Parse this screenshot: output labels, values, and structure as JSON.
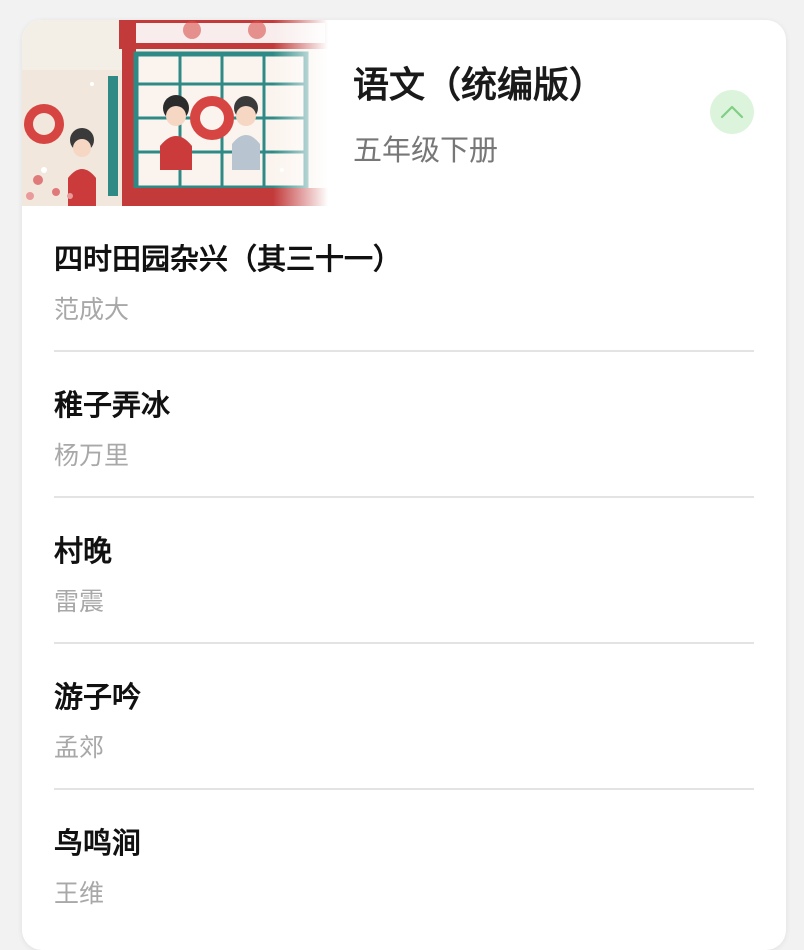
{
  "book": {
    "title": "语文（统编版）",
    "subtitle": "五年级下册",
    "cover_icon": "textbook-cover-illustration"
  },
  "collapse_icon": "chevron-up-icon",
  "colors": {
    "collapse_bg": "#dcf3dc",
    "collapse_chevron": "#7fcf85",
    "divider": "#e3e3e3"
  },
  "poems": [
    {
      "title": "四时田园杂兴（其三十一）",
      "author": "范成大"
    },
    {
      "title": "稚子弄冰",
      "author": "杨万里"
    },
    {
      "title": "村晚",
      "author": "雷震"
    },
    {
      "title": "游子吟",
      "author": "孟郊"
    },
    {
      "title": "鸟鸣涧",
      "author": "王维"
    }
  ]
}
